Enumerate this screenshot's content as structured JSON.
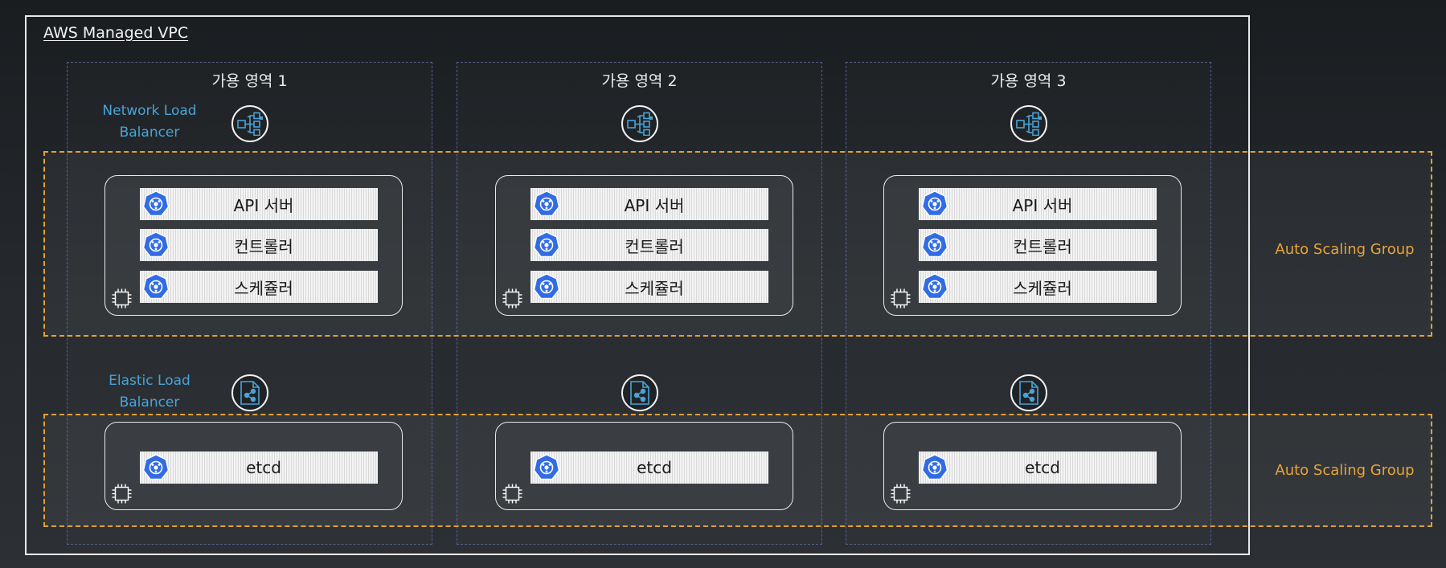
{
  "vpc": {
    "title": "AWS Managed VPC"
  },
  "availability_zones": [
    {
      "title": "가용 영역 1"
    },
    {
      "title": "가용 영역 2"
    },
    {
      "title": "가용 영역 3"
    }
  ],
  "network_load_balancer": {
    "label": "Network Load Balancer",
    "icon": "network-load-balancer-icon"
  },
  "elastic_load_balancer": {
    "label": "Elastic Load Balancer",
    "icon": "elastic-load-balancer-icon"
  },
  "control_plane_group": {
    "label": "Auto Scaling Group"
  },
  "etcd_group": {
    "label": "Auto Scaling Group"
  },
  "control_plane_components": [
    "API 서버",
    "컨트롤러",
    "스케쥴러"
  ],
  "etcd_component": "etcd",
  "colors": {
    "border": "#e9e9e9",
    "zone_border": "#565e88",
    "asg": "#e2a033",
    "load_balancer_label": "#4aa3d8",
    "kubernetes_blue": "#326ce5"
  }
}
